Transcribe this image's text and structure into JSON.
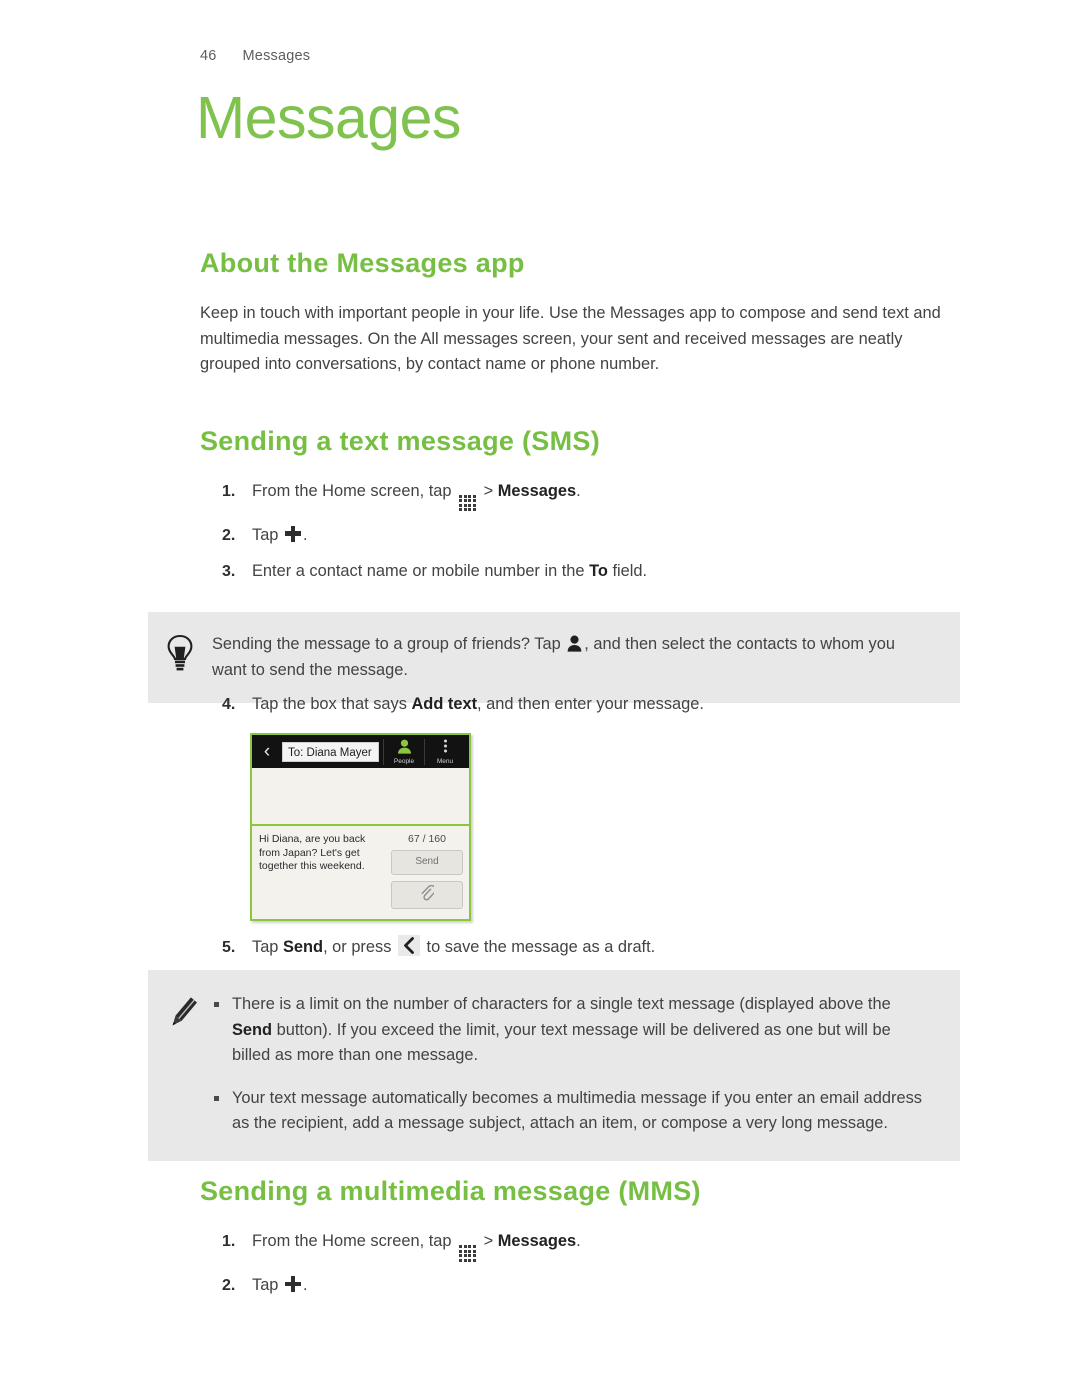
{
  "running_header": {
    "page_number": "46",
    "chapter": "Messages"
  },
  "chapter_title": "Messages",
  "colors": {
    "title_green": "#80c24e",
    "heading_green": "#76bf43",
    "callout_bg": "#e8e8e8",
    "screenshot_border": "#8cc63f"
  },
  "sections": {
    "about": {
      "heading": "About the Messages app",
      "paragraph": "Keep in touch with important people in your life. Use the Messages app to compose and send text and multimedia messages. On the All messages screen, your sent and received messages are neatly grouped into conversations, by contact name or phone number."
    },
    "sms": {
      "heading": "Sending a text message (SMS)",
      "step1": {
        "num": "1.",
        "pre": "From the Home screen, tap",
        "sep": ">",
        "bold": "Messages",
        "post": "."
      },
      "step2": {
        "num": "2.",
        "pre": "Tap",
        "post": "."
      },
      "step3": {
        "num": "3.",
        "pre": "Enter a contact name or mobile number in the",
        "bold": "To",
        "post": "field."
      },
      "step4": {
        "num": "4.",
        "pre": "Tap the box that says",
        "bold": "Add text",
        "post": ", and then enter your message."
      },
      "step5": {
        "num": "5.",
        "pre": "Tap",
        "bold": "Send",
        "mid": ", or press",
        "post": "to save the message as a draft."
      }
    },
    "mms": {
      "heading": "Sending a multimedia message (MMS)",
      "step1": {
        "num": "1.",
        "pre": "From the Home screen, tap",
        "sep": ">",
        "bold": "Messages",
        "post": "."
      },
      "step2": {
        "num": "2.",
        "pre": "Tap",
        "post": "."
      }
    }
  },
  "tip_callout": {
    "icon": "lightbulb-icon",
    "pre": "Sending the message to a group of friends? Tap",
    "post": ", and then select the contacts to whom you want to send the message."
  },
  "note_callout": {
    "icon": "pencil-icon",
    "bullets": [
      {
        "pre": "There is a limit on the number of characters for a single text message (displayed above the",
        "bold": "Send",
        "post": "button). If you exceed the limit, your text message will be delivered as one but will be billed as more than one message."
      },
      {
        "text": "Your text message automatically becomes a multimedia message if you enter an email address as the recipient, add a message subject, attach an item, or compose a very long message."
      }
    ]
  },
  "phone_screenshot": {
    "back_glyph": "‹",
    "to_field": "To: Diana Mayer",
    "people_label": "People",
    "menu_label": "Menu",
    "message_text": "Hi Diana, are you back from Japan? Let's get together this weekend.",
    "char_count": "67 / 160",
    "send_label": "Send",
    "attach_icon": "paperclip-icon"
  }
}
